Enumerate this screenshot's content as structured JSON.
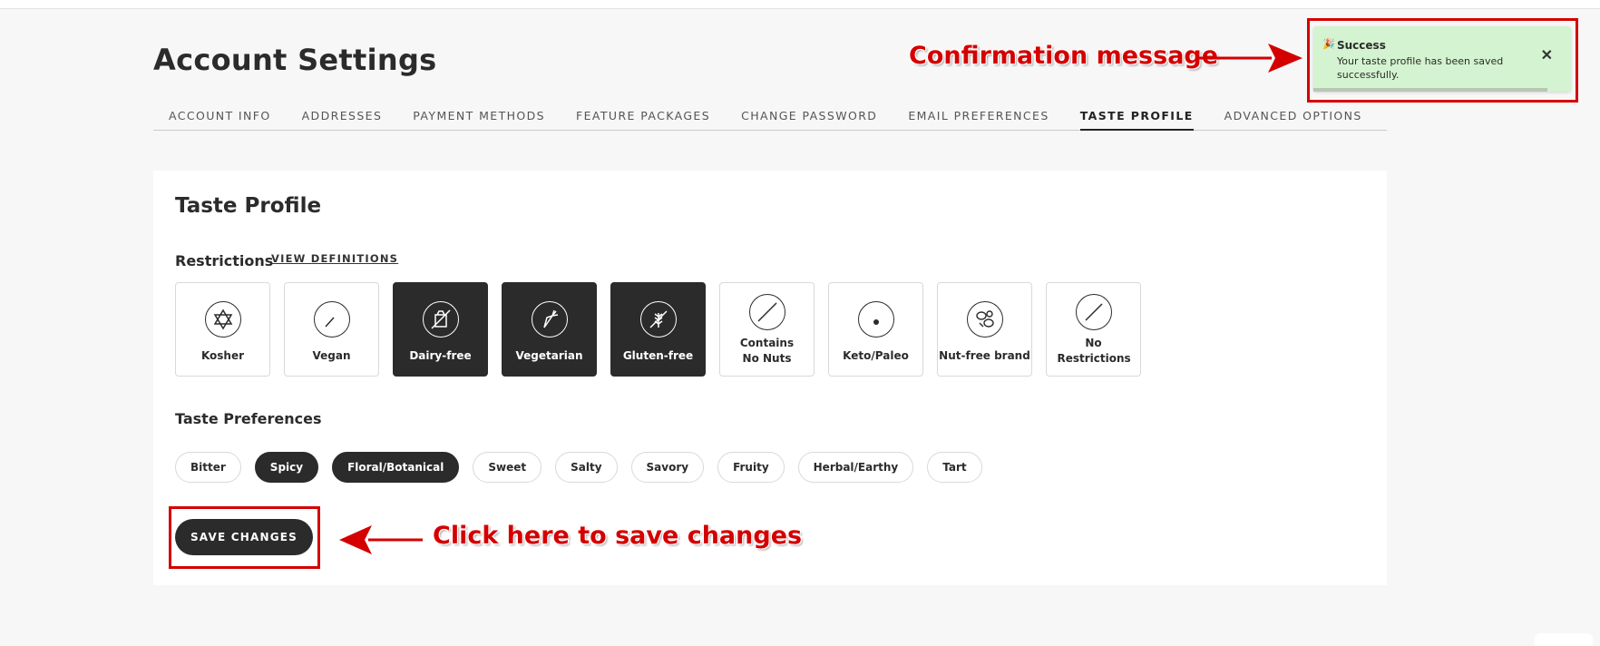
{
  "page": {
    "title": "Account Settings"
  },
  "tabs": [
    {
      "label": "ACCOUNT INFO",
      "active": false
    },
    {
      "label": "ADDRESSES",
      "active": false
    },
    {
      "label": "PAYMENT METHODS",
      "active": false
    },
    {
      "label": "FEATURE PACKAGES",
      "active": false
    },
    {
      "label": "CHANGE PASSWORD",
      "active": false
    },
    {
      "label": "EMAIL PREFERENCES",
      "active": false
    },
    {
      "label": "TASTE PROFILE",
      "active": true
    },
    {
      "label": "ADVANCED OPTIONS",
      "active": false
    }
  ],
  "card": {
    "title": "Taste Profile",
    "restrictions_label": "Restrictions",
    "view_definitions": "VIEW DEFINITIONS",
    "restrictions": [
      {
        "label": "Kosher",
        "icon": "star-of-david-icon",
        "selected": false
      },
      {
        "label": "Vegan",
        "icon": "leaf-icon",
        "selected": false
      },
      {
        "label": "Dairy-free",
        "icon": "no-dairy-icon",
        "selected": true
      },
      {
        "label": "Vegetarian",
        "icon": "carrot-icon",
        "selected": true
      },
      {
        "label": "Gluten-free",
        "icon": "no-wheat-icon",
        "selected": true
      },
      {
        "label": "Contains No Nuts",
        "icon": "no-peanut-icon",
        "selected": false
      },
      {
        "label": "Keto/Paleo",
        "icon": "avocado-icon",
        "selected": false
      },
      {
        "label": "Nut-free brand",
        "icon": "nuts-icon",
        "selected": false
      },
      {
        "label": "No Restrictions",
        "icon": "no-restrictions-icon",
        "selected": false
      }
    ],
    "preferences_label": "Taste Preferences",
    "preferences": [
      {
        "label": "Bitter",
        "selected": false
      },
      {
        "label": "Spicy",
        "selected": true
      },
      {
        "label": "Floral/Botanical",
        "selected": true
      },
      {
        "label": "Sweet",
        "selected": false
      },
      {
        "label": "Salty",
        "selected": false
      },
      {
        "label": "Savory",
        "selected": false
      },
      {
        "label": "Fruity",
        "selected": false
      },
      {
        "label": "Herbal/Earthy",
        "selected": false
      },
      {
        "label": "Tart",
        "selected": false
      }
    ],
    "save_label": "SAVE CHANGES"
  },
  "toast": {
    "icon": "party-popper-icon",
    "title": "Success",
    "message": "Your taste profile has been saved successfully.",
    "close": "✕",
    "progress": 0.91
  },
  "annotations": {
    "confirmation": "Confirmation message",
    "save": "Click here to save changes"
  },
  "colors": {
    "dark": "#2b2b2b",
    "toast_bg": "#d4f3d0",
    "annotation_red": "#d40000",
    "page_bg": "#f7f7f7"
  }
}
